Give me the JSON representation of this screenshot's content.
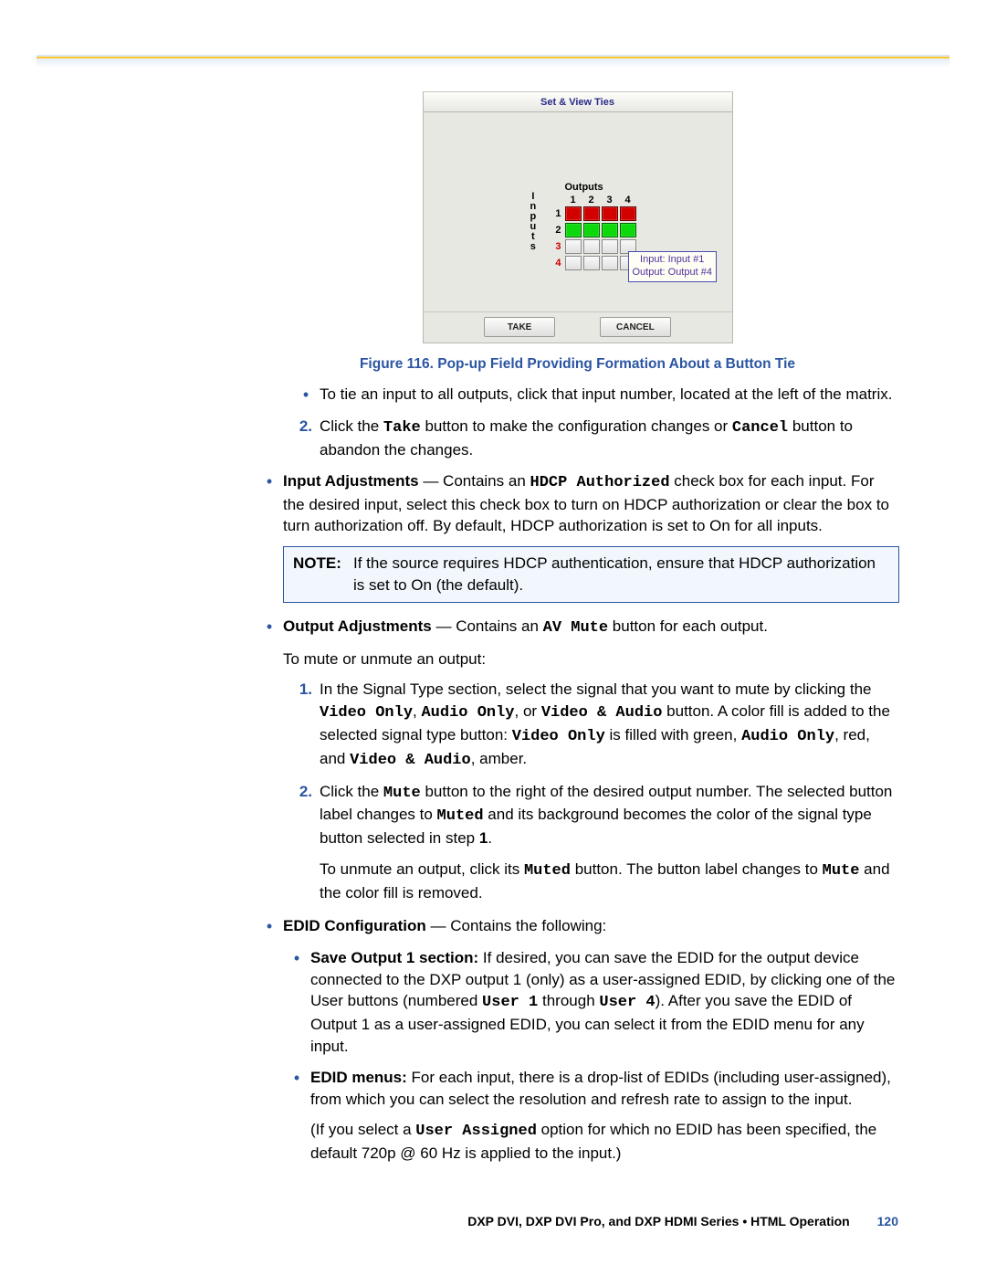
{
  "dialog": {
    "title": "Set & View Ties",
    "outputs_label": "Outputs",
    "inputs_label": "I\nn\np\nu\nt\ns",
    "col_headers": [
      "1",
      "2",
      "3",
      "4"
    ],
    "rows": [
      {
        "num": "1",
        "red": false,
        "cells": [
          "red",
          "red",
          "red",
          "red"
        ]
      },
      {
        "num": "2",
        "red": false,
        "cells": [
          "green",
          "green",
          "green",
          "green"
        ]
      },
      {
        "num": "3",
        "red": true,
        "cells": [
          "",
          "",
          "",
          ""
        ]
      },
      {
        "num": "4",
        "red": true,
        "cells": [
          "",
          "",
          "",
          ""
        ]
      }
    ],
    "tooltip_line1": "Input: Input #1",
    "tooltip_line2": "Output: Output #4",
    "take_label": "TAKE",
    "cancel_label": "CANCEL"
  },
  "figure_caption": "Figure 116.  Pop-up Field Providing Formation About a Button Tie",
  "top_bullet": "To tie an input to all outputs, click that input number, located at the left of the matrix.",
  "step2_lead": "Click the ",
  "step2_take": "Take",
  "step2_mid": " button to make the configuration changes or ",
  "step2_cancel": "Cancel",
  "step2_tail": " button to abandon the changes.",
  "input_adj_head": "Input Adjustments",
  "input_adj_body_pre": " — Contains an ",
  "input_adj_mono": "HDCP Authorized",
  "input_adj_body_post": " check box for each input. For the desired input, select this check box to turn on HDCP authorization or clear the box to turn authorization off. By default, HDCP authorization is set to On for all inputs.",
  "note_label": "NOTE:",
  "note_body": "If the source requires HDCP authentication, ensure that HDCP authorization is set to On (the default).",
  "output_adj_head": "Output Adjustments",
  "output_adj_body_pre": " — Contains an ",
  "output_adj_mono": "AV Mute",
  "output_adj_body_post": " button for each output.",
  "mute_intro": "To mute or unmute an output:",
  "m1_lead": "In the Signal Type section, select the signal that you want to mute by clicking the ",
  "m1_vo": "Video Only",
  "m1_sep1": ", ",
  "m1_ao": "Audio Only",
  "m1_sep2": ", or ",
  "m1_va": "Video & Audio",
  "m1_tail1": " button. A color fill is added to the selected signal type button: ",
  "m1_vo2": "Video Only",
  "m1_tail2": " is filled with green, ",
  "m1_ao2": "Audio Only",
  "m1_tail3": ", red, and ",
  "m1_va2": "Video & Audio",
  "m1_tail4": ", amber.",
  "m2_lead": "Click the ",
  "m2_mute": "Mute",
  "m2_mid": " button to the right of the desired output number. The selected button label changes to ",
  "m2_muted": "Muted",
  "m2_end": " and its background becomes the color of the signal type button selected in step ",
  "m2_step": "1",
  "m2_period": ".",
  "unmute_lead": "To unmute an output, click its ",
  "unmute_muted": "Muted",
  "unmute_mid": " button. The button label changes to ",
  "unmute_mute": "Mute",
  "unmute_end": " and the color fill is removed.",
  "edid_head": "EDID Configuration",
  "edid_body": " — Contains the following:",
  "edid_save_head": "Save Output 1 section:",
  "edid_save_pre": "  If desired, you can save the EDID for the output device connected to the DXP output 1 (only) as a user-assigned EDID, by clicking one of the User buttons (numbered ",
  "edid_u1": "User 1",
  "edid_mid": " through ",
  "edid_u4": "User 4",
  "edid_save_post": "). After you save the EDID of Output 1 as a user-assigned EDID, you can select it from the EDID menu for any input.",
  "edid_menu_head": "EDID menus:",
  "edid_menu_body": " For each input, there is a drop-list of EDIDs (including user-assigned), from which you can select the resolution and refresh rate to assign to the input.",
  "edid_para2_lead": "(If you select a ",
  "edid_para2_mono": "User Assigned",
  "edid_para2_tail": " option for which no EDID has been specified, the default 720p @ 60 Hz is applied to the input.)",
  "footer_doc": "DXP DVI, DXP DVI Pro, and DXP HDMI Series • HTML Operation",
  "footer_page": "120"
}
